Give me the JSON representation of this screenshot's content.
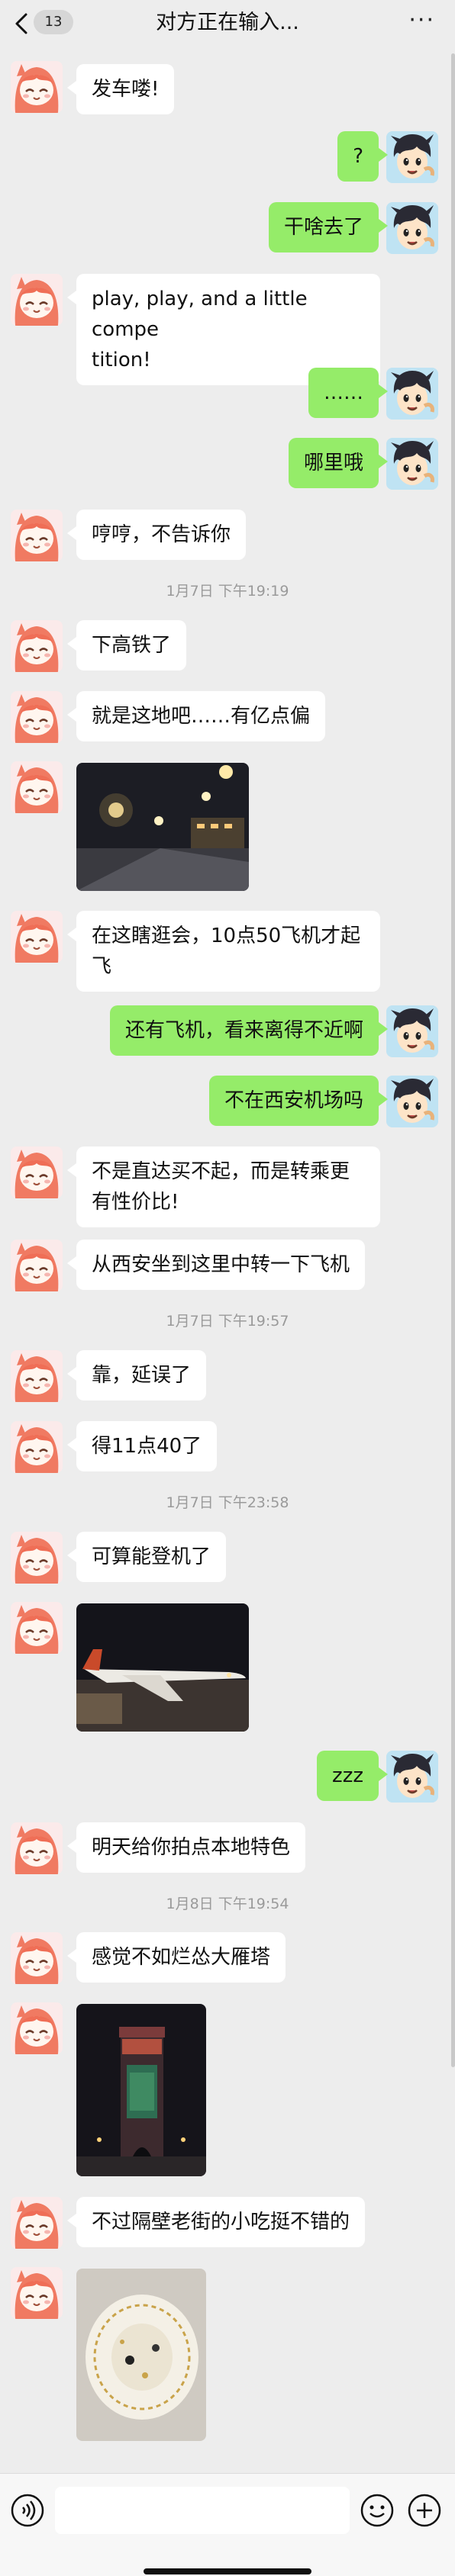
{
  "header": {
    "unread_count": "13",
    "title": "对方正在输入...",
    "more": "···"
  },
  "messages": {
    "m1": "发车喽!",
    "m2": "?",
    "m3": "干啥去了",
    "m4": "play, play, and a little compe\ntition!",
    "m5": "……",
    "m6": "哪里哦",
    "m7": "哼哼，不告诉你",
    "t1": "1月7日 下午19:19",
    "m8": "下高铁了",
    "m9": "就是这地吧……有亿点偏",
    "m11": "在这瞎逛会，10点50飞机才起\n飞",
    "m12": "还有飞机，看来离得不近啊",
    "m13": "不在西安机场吗",
    "m14": "不是直达买不起，而是转乘更\n有性价比!",
    "m15": "从西安坐到这里中转一下飞机",
    "t2": "1月7日 下午19:57",
    "m16": "靠，延误了",
    "m17": "得11点40了",
    "t3": "1月7日 下午23:58",
    "m18": "可算能登机了",
    "m20": "zzz",
    "m21": "明天给你拍点本地特色",
    "t4": "1月8日 下午19:54",
    "m22": "感觉不如烂怂大雁塔",
    "m24": "不过隔壁老街的小吃挺不错的"
  },
  "input": {
    "value": ""
  },
  "colors": {
    "background": "#ededed",
    "self_bubble": "#95ec69",
    "other_bubble": "#ffffff",
    "timestamp": "#9a9a9a"
  },
  "icons": {
    "back": "chevron-left-icon",
    "more": "ellipsis-icon",
    "voice": "voice-icon",
    "emoji": "emoji-icon",
    "plus": "plus-icon"
  }
}
